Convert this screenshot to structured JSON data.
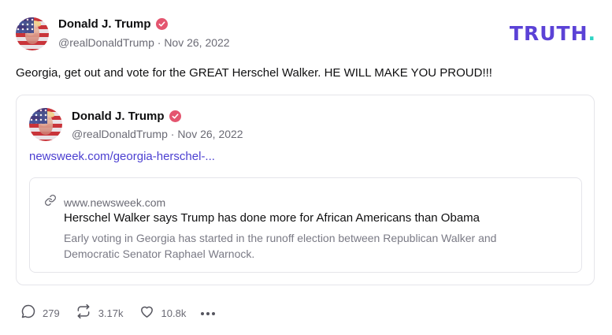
{
  "brand": {
    "logo_text": "TRUTH",
    "logo_dot": ".",
    "logo_color": "#5b42d6",
    "dot_color": "#2fd4c4"
  },
  "post": {
    "author_name": "Donald J. Trump",
    "handle": "@realDonaldTrump",
    "separator": "·",
    "date": "Nov 26, 2022",
    "text": "Georgia, get out and vote for the GREAT Herschel Walker. HE WILL MAKE YOU PROUD!!!"
  },
  "quoted_post": {
    "author_name": "Donald J. Trump",
    "handle": "@realDonaldTrump",
    "separator": "·",
    "date": "Nov 26, 2022",
    "link_text": "newsweek.com/georgia-herschel-...",
    "link_card": {
      "domain": "www.newsweek.com",
      "title": "Herschel Walker says Trump has done more for African Americans than Obama",
      "description": "Early voting in Georgia has started in the runoff election between Republican Walker and Democratic Senator Raphael Warnock."
    }
  },
  "actions": {
    "replies": "279",
    "retruths": "3.17k",
    "likes": "10.8k"
  },
  "icons": [
    "verified-badge-icon",
    "link-icon",
    "reply-icon",
    "retruth-icon",
    "like-icon",
    "more-icon"
  ],
  "colors": {
    "verified": "#e4556f",
    "link": "#4b3fd1"
  }
}
